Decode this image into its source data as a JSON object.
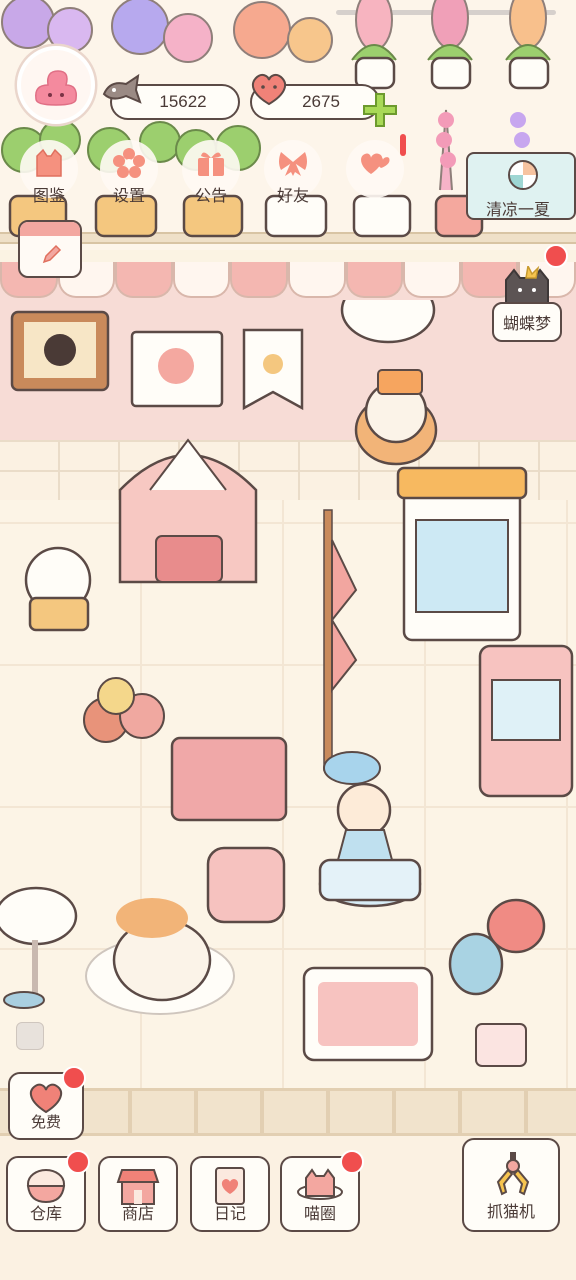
{
  "currencies": {
    "fish_coins": "15622",
    "hearts": "2675"
  },
  "menu": [
    {
      "label": "图鉴",
      "icon": "cat-book-icon"
    },
    {
      "label": "设置",
      "icon": "gear-flower-icon"
    },
    {
      "label": "公告",
      "icon": "gift-box-icon"
    },
    {
      "label": "好友",
      "icon": "bow-ribbon-icon"
    },
    {
      "label": "",
      "icon": "double-heart-icon"
    }
  ],
  "event": {
    "label": "清凉一夏"
  },
  "friend": {
    "label": "蝴蝶梦"
  },
  "bottom_nav": {
    "free": "免费",
    "warehouse": "仓库",
    "shop": "商店",
    "diary": "日记",
    "cat_circle": "喵圈",
    "claw_machine": "抓猫机"
  },
  "colors": {
    "accent_pink": "#f3a7a0",
    "outline": "#5b4a46",
    "badge_red": "#f04e4e",
    "plus_green": "#a9d957"
  }
}
